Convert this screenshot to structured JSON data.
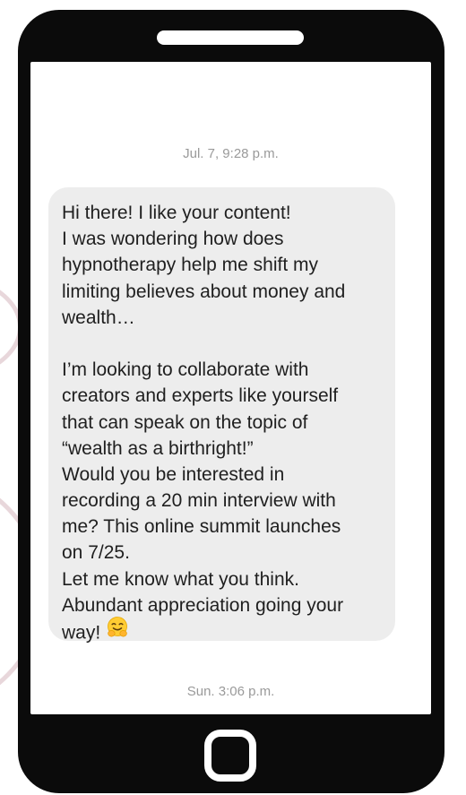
{
  "conversation": {
    "first_timestamp": "Jul. 7, 9:28 p.m.",
    "last_timestamp": "Sun. 3:06 p.m.",
    "message": {
      "lines": [
        "Hi there! I like your content!",
        "I was wondering how does",
        "hypnotherapy help me shift my",
        "limiting believes about money and",
        "wealth…",
        "",
        "I’m looking to collaborate with",
        "creators and experts like yourself",
        "that can speak on the topic of",
        "“wealth as a birthright!”",
        "Would you be interested in",
        "recording a 20 min interview with",
        "me? This online summit launches",
        "on 7/25.",
        "Let me know what you think.",
        "Abundant appreciation going your",
        "way!"
      ],
      "emoji": "hugging-face-icon"
    }
  },
  "colors": {
    "phone_body": "#0b0b0b",
    "screen": "#ffffff",
    "bubble": "#ededed",
    "message_text": "#1f1f1f",
    "timestamp_text": "#9a9a9a",
    "decor_arc": "#e8d7db"
  }
}
